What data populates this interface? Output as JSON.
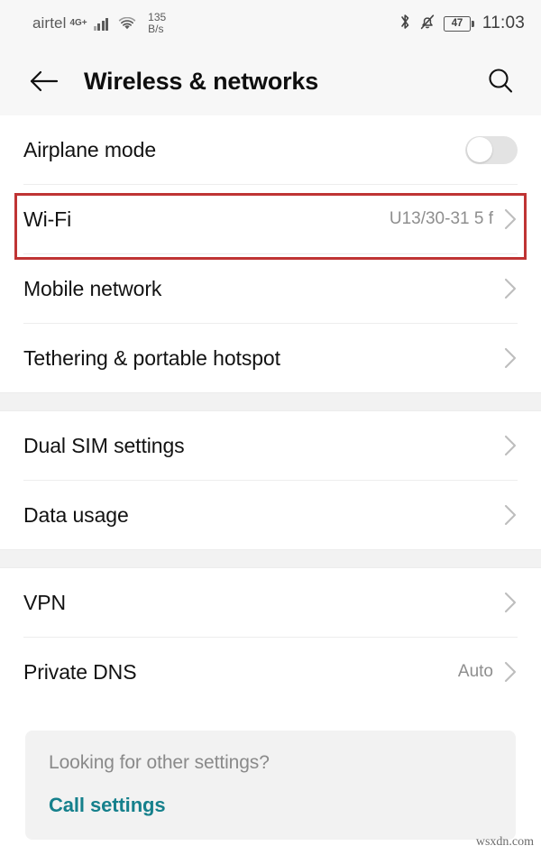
{
  "status_bar": {
    "carrier": "airtel",
    "network_type": "4G+",
    "signal_icon": "signal-bars-icon",
    "wifi_icon": "wifi-icon",
    "net_speed_value": "135",
    "net_speed_unit": "B/s",
    "bluetooth_icon": "bluetooth-icon",
    "silent_icon": "bell-muted-icon",
    "battery_percent": "47",
    "battery_icon": "battery-icon",
    "time": "11:03"
  },
  "app_bar": {
    "back_icon": "arrow-left-icon",
    "title": "Wireless & networks",
    "search_icon": "search-icon"
  },
  "groups": [
    {
      "rows": [
        {
          "label": "Airplane mode",
          "value": "",
          "control": "toggle",
          "toggle_on": false
        },
        {
          "label": "Wi-Fi",
          "value": "U13/30-31 5 f",
          "control": "chevron",
          "highlighted": true
        },
        {
          "label": "Mobile network",
          "value": "",
          "control": "chevron"
        },
        {
          "label": "Tethering & portable hotspot",
          "value": "",
          "control": "chevron"
        }
      ]
    },
    {
      "rows": [
        {
          "label": "Dual SIM settings",
          "value": "",
          "control": "chevron"
        },
        {
          "label": "Data usage",
          "value": "",
          "control": "chevron"
        }
      ]
    },
    {
      "rows": [
        {
          "label": "VPN",
          "value": "",
          "control": "chevron"
        },
        {
          "label": "Private DNS",
          "value": "Auto",
          "control": "chevron"
        }
      ]
    }
  ],
  "other_settings_card": {
    "prompt": "Looking for other settings?",
    "link_label": "Call settings"
  },
  "watermark": "wsxdn.com",
  "colors": {
    "accent_link": "#15808c",
    "annotation_red": "#bf3434",
    "chrome_background": "#f7f7f7",
    "group_gap": "#f2f2f2"
  }
}
